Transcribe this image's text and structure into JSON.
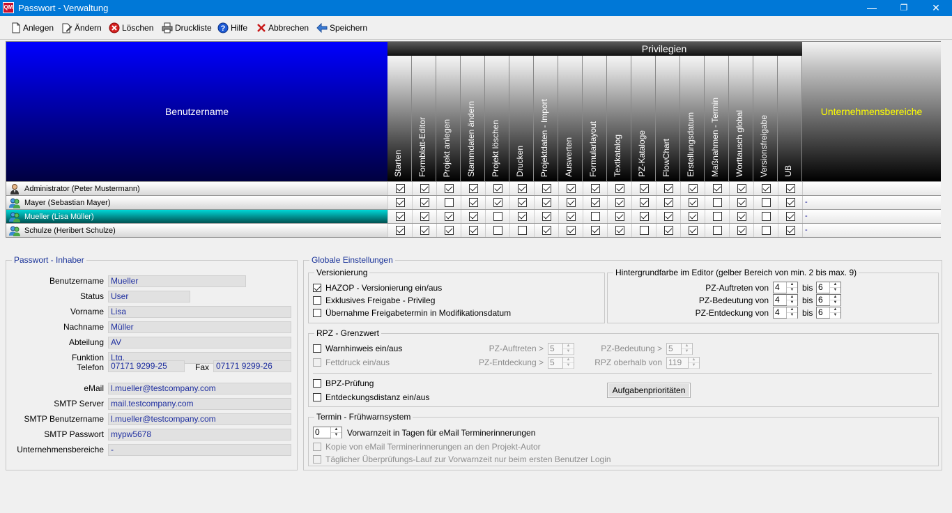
{
  "window": {
    "icon_text": "QM",
    "title": "Passwort - Verwaltung",
    "minimize": "—",
    "maximize": "❐",
    "close": "✕"
  },
  "toolbar": {
    "anlegen": "Anlegen",
    "aendern": "Ändern",
    "loeschen": "Löschen",
    "druckliste": "Druckliste",
    "hilfe": "Hilfe",
    "abbrechen": "Abbrechen",
    "speichern": "Speichern"
  },
  "grid": {
    "privileges_title": "Privilegien",
    "user_header": "Benutzername",
    "ub_header": "Unternehmensbereiche",
    "columns": [
      "Starten",
      "Formblatt-Editor",
      "Projekt anlegen",
      "Stammdaten ändern",
      "Projekt löschen",
      "Drucken",
      "Projektdaten - Import",
      "Auswerten",
      "Formularlayout",
      "Textkatalog",
      "PZ-Kataloge",
      "FlowChart",
      "Erstellungsdatum",
      "Maßnahmen - Termin",
      "Worttausch global",
      "Versionsfreigabe",
      "UB"
    ],
    "rows": [
      {
        "name": "Administrator  (Peter Mustermann)",
        "icon": "admin-user-icon",
        "checks": [
          1,
          1,
          1,
          1,
          1,
          1,
          1,
          1,
          1,
          1,
          1,
          1,
          1,
          1,
          1,
          1,
          1
        ],
        "ub": ""
      },
      {
        "name": "Mayer  (Sebastian Mayer)",
        "icon": "users-icon",
        "checks": [
          1,
          1,
          0,
          1,
          1,
          1,
          1,
          1,
          1,
          1,
          1,
          1,
          1,
          0,
          1,
          0,
          1
        ],
        "ub": "-"
      },
      {
        "name": "Mueller  (Lisa Müller)",
        "icon": "users-icon",
        "checks": [
          1,
          1,
          1,
          1,
          0,
          1,
          1,
          1,
          0,
          1,
          1,
          1,
          1,
          0,
          1,
          0,
          1
        ],
        "ub": "-",
        "selected": true
      },
      {
        "name": "Schulze  (Heribert Schulze)",
        "icon": "users-icon",
        "checks": [
          1,
          1,
          1,
          1,
          0,
          0,
          1,
          1,
          1,
          1,
          0,
          1,
          1,
          0,
          1,
          0,
          1
        ],
        "ub": "-"
      }
    ]
  },
  "owner": {
    "title": "Passwort - Inhaber",
    "benutzername_label": "Benutzername",
    "benutzername": "Mueller",
    "status_label": "Status",
    "status": "User",
    "vorname_label": "Vorname",
    "vorname": "Lisa",
    "nachname_label": "Nachname",
    "nachname": "Müller",
    "abteilung_label": "Abteilung",
    "abteilung": "AV",
    "funktion_label": "Funktion",
    "funktion": "Ltg.",
    "telefon_label": "Telefon",
    "telefon": "07171 9299-25",
    "fax_label": "Fax",
    "fax": "07171 9299-26",
    "email_label": "eMail",
    "email": "l.mueller@testcompany.com",
    "smtp_server_label": "SMTP Server",
    "smtp_server": "mail.testcompany.com",
    "smtp_user_label": "SMTP Benutzername",
    "smtp_user": "l.mueller@testcompany.com",
    "smtp_pass_label": "SMTP Passwort",
    "smtp_pass": "mypw5678",
    "ub_label": "Unternehmensbereiche",
    "ub": "-"
  },
  "global": {
    "title": "Globale Einstellungen",
    "versionierung": {
      "title": "Versionierung",
      "hazop": "HAZOP - Versionierung ein/aus",
      "hazop_checked": true,
      "exklusiv": "Exklusives Freigabe - Privileg",
      "uebernahme": "Übernahme Freigabetermin in Modifikationsdatum"
    },
    "hintergrund": {
      "title": "Hintergrundfarbe im Editor (gelber Bereich von min. 2 bis max. 9)",
      "rows": [
        {
          "label": "PZ-Auftreten von",
          "from": "4",
          "bis": "bis",
          "to": "6"
        },
        {
          "label": "PZ-Bedeutung von",
          "from": "4",
          "bis": "bis",
          "to": "6"
        },
        {
          "label": "PZ-Entdeckung von",
          "from": "4",
          "bis": "bis",
          "to": "6"
        }
      ]
    },
    "rpz": {
      "title": "RPZ - Grenzwert",
      "warnhinweis": "Warnhinweis ein/aus",
      "fettdruck": "Fettdruck ein/aus",
      "pz_auftreten": "PZ-Auftreten >",
      "pz_auftreten_val": "5",
      "pz_bedeutung": "PZ-Bedeutung >",
      "pz_bedeutung_val": "5",
      "pz_entdeckung": "PZ-Entdeckung >",
      "pz_entdeckung_val": "5",
      "rpz_oberhalb": "RPZ oberhalb von",
      "rpz_oberhalb_val": "119",
      "bpz": "BPZ-Prüfung",
      "entdeckungsdistanz": "Entdeckungsdistanz ein/aus",
      "aufgaben_button": "Aufgabenprioritäten"
    },
    "termin": {
      "title": "Termin - Frühwarnsystem",
      "vorwarnzeit_val": "0",
      "vorwarnzeit": "Vorwarnzeit in Tagen für eMail Terminerinnerungen",
      "kopie": "Kopie von eMail Terminerinnerungen an den Projekt-Autor",
      "taeglich": "Täglicher Überprüfungs-Lauf zur Vorwarnzeit nur beim ersten Benutzer Login"
    }
  }
}
